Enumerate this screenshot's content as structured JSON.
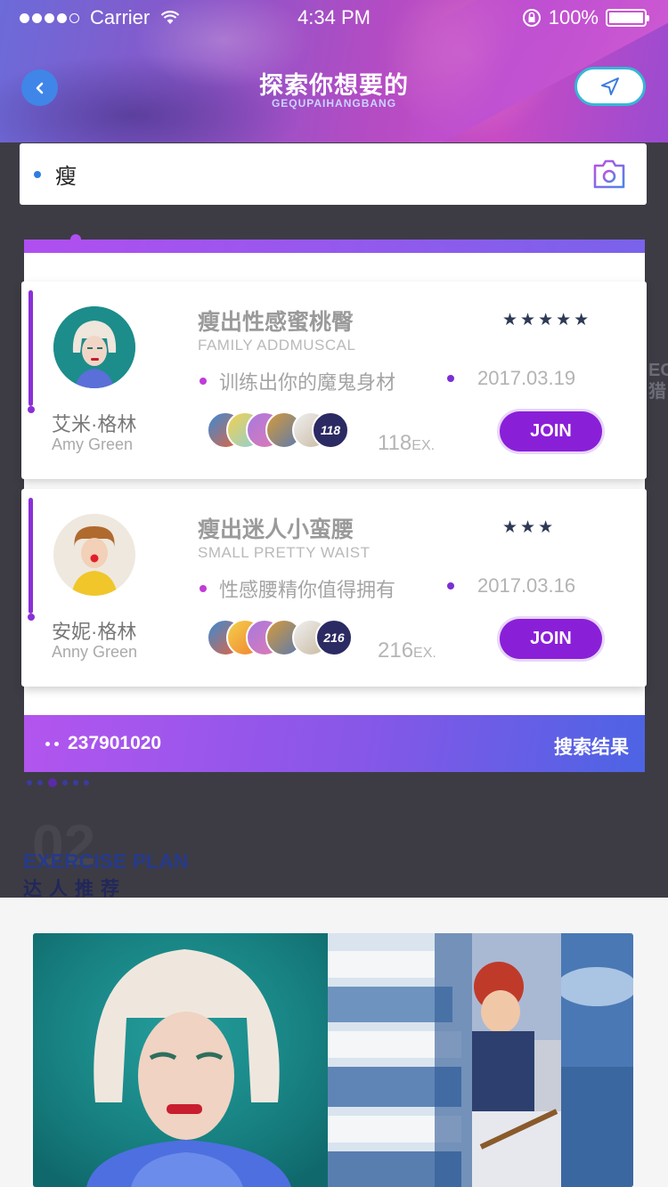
{
  "status_bar": {
    "carrier": "Carrier",
    "time": "4:34 PM",
    "battery": "100%"
  },
  "header": {
    "title": "探索你想要的",
    "subtitle": "GEQUPAIHANGBANG"
  },
  "search": {
    "value": "瘦"
  },
  "results": {
    "count": "237901020",
    "label": "搜索结果",
    "items": [
      {
        "name_cn": "艾米·格林",
        "name_en": "Amy Green",
        "title": "瘦出性感蜜桃臀",
        "subtitle": "FAMILY ADDMUSCAL",
        "rating": "★★★★★",
        "description": "训练出你的魔鬼身材",
        "date": "2017.03.19",
        "participants": "118",
        "ex_count": "118",
        "ex_unit": "EX.",
        "join_label": "JOIN"
      },
      {
        "name_cn": "安妮·格林",
        "name_en": "Anny Green",
        "title": "瘦出迷人小蛮腰",
        "subtitle": "SMALL PRETTY WAIST",
        "rating": "★★★",
        "description": "性感腰精你值得拥有",
        "date": "2017.03.16",
        "participants": "216",
        "ex_count": "216",
        "ex_unit": "EX.",
        "join_label": "JOIN"
      }
    ]
  },
  "section": {
    "number": "02",
    "title_en": "EXERCISE PLAN",
    "title_cn": "达人推荐"
  },
  "colors": {
    "accent_purple": "#8a1fd8",
    "gradient_start": "#b355ef",
    "gradient_end": "#4c64e4",
    "back_button": "#3f86e8",
    "background_dark": "#3d3c45"
  }
}
